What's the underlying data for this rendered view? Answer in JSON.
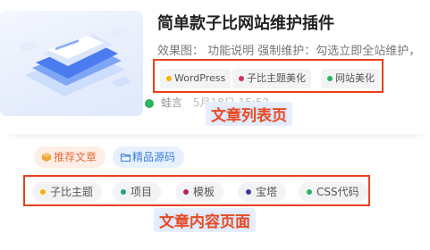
{
  "article": {
    "title": "简单款子比网站维护插件",
    "excerpt": "效果图： 功能说明 强制维护：勾选立即全站维护，",
    "tags": [
      {
        "label": "WordPress",
        "color": "#f5b400"
      },
      {
        "label": "子比主题美化",
        "color": "#d6315b"
      },
      {
        "label": "网站美化",
        "color": "#2bb45a"
      }
    ],
    "author": "蛙言",
    "time": "5月18日 15:52",
    "overlay_label": "文章列表页"
  },
  "post": {
    "categories": [
      {
        "label": "推荐文章",
        "color": "#e86d3c",
        "icon": "cube-icon"
      },
      {
        "label": "精品源码",
        "color": "#3d7fd6",
        "icon": "folder-icon"
      }
    ],
    "tags": [
      {
        "label": "子比主题",
        "color": "#f5b400"
      },
      {
        "label": "项目",
        "color": "#1aa58a"
      },
      {
        "label": "模板",
        "color": "#b2245a"
      },
      {
        "label": "宝塔",
        "color": "#3b3b9a"
      },
      {
        "label": "CSS代码",
        "color": "#2bb45a"
      }
    ],
    "overlay_label": "文章内容页面"
  }
}
